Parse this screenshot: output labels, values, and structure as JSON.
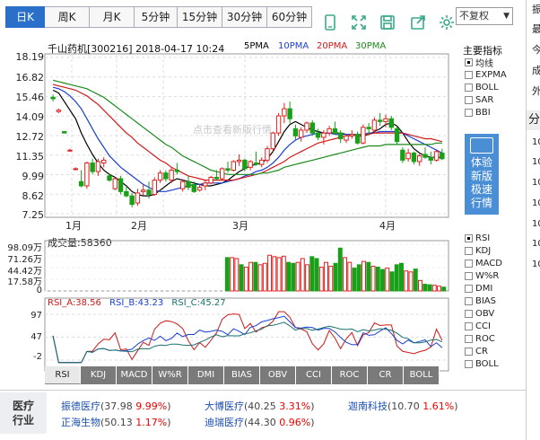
{
  "period_tabs": [
    {
      "label": "日K",
      "active": true
    },
    {
      "label": "周K",
      "active": false
    },
    {
      "label": "月K",
      "active": false
    },
    {
      "label": "5分钟",
      "active": false
    },
    {
      "label": "15分钟",
      "active": false
    },
    {
      "label": "30分钟",
      "active": false
    },
    {
      "label": "60分钟",
      "active": false
    }
  ],
  "toolbar_icons": [
    "phone-icon",
    "fullscreen-icon",
    "save-icon",
    "share-icon",
    "settings-icon"
  ],
  "fuquan": {
    "selected": "不复权"
  },
  "chart_header": {
    "stock_name": "千山药机",
    "code": "[300216]",
    "datetime": "2018-04-17 10:24",
    "ma_labels": [
      {
        "label": "5PMA",
        "color": "#000000"
      },
      {
        "label": "10PMA",
        "color": "#1a3fd0"
      },
      {
        "label": "20PMA",
        "color": "#d01818"
      },
      {
        "label": "30PMA",
        "color": "#1a8a1a"
      }
    ]
  },
  "watermark": "点击查看新版行情",
  "chart_data": {
    "type": "candlestick",
    "price_axis": {
      "ticks": [
        "18.19",
        "16.82",
        "15.46",
        "14.09",
        "12.72",
        "11.35",
        "9.99",
        "8.62",
        "7.25"
      ],
      "min": 7.25,
      "max": 18.19
    },
    "x_labels": [
      "1月",
      "2月",
      "3月",
      "4月"
    ],
    "candles": [
      [
        15.4,
        15.6,
        15.1,
        15.3
      ],
      [
        14.4,
        14.6,
        14.3,
        14.5
      ],
      [
        13.0,
        13.0,
        12.9,
        12.9
      ],
      [
        11.7,
        11.8,
        11.6,
        11.7
      ],
      [
        10.4,
        10.5,
        10.3,
        10.4
      ],
      [
        9.5,
        10.3,
        9.1,
        9.2
      ],
      [
        9.2,
        10.9,
        9.0,
        10.8
      ],
      [
        10.8,
        11.1,
        10.0,
        10.2
      ],
      [
        10.2,
        11.1,
        9.9,
        10.9
      ],
      [
        10.8,
        11.2,
        10.5,
        11.0
      ],
      [
        9.9,
        10.1,
        9.5,
        9.6
      ],
      [
        9.0,
        9.8,
        8.9,
        9.7
      ],
      [
        9.7,
        9.9,
        8.6,
        8.8
      ],
      [
        8.8,
        9.2,
        8.4,
        8.5
      ],
      [
        8.5,
        8.7,
        7.7,
        7.9
      ],
      [
        8.0,
        9.0,
        7.8,
        8.7
      ],
      [
        8.8,
        9.3,
        8.5,
        8.9
      ],
      [
        8.9,
        9.5,
        8.3,
        8.6
      ],
      [
        8.6,
        9.8,
        8.5,
        9.6
      ],
      [
        9.6,
        10.3,
        9.4,
        10.1
      ],
      [
        10.1,
        10.3,
        9.5,
        9.7
      ],
      [
        9.6,
        10.5,
        9.4,
        10.3
      ],
      [
        10.3,
        10.8,
        10.0,
        10.2
      ],
      [
        9.0,
        9.6,
        8.8,
        9.5
      ],
      [
        9.5,
        9.9,
        8.9,
        9.1
      ],
      [
        9.3,
        9.5,
        8.7,
        8.8
      ],
      [
        8.9,
        9.3,
        8.8,
        9.1
      ],
      [
        9.2,
        9.6,
        8.9,
        9.4
      ],
      [
        9.4,
        9.9,
        9.3,
        9.8
      ],
      [
        9.8,
        10.3,
        9.6,
        9.7
      ],
      [
        9.7,
        10.5,
        9.6,
        10.4
      ],
      [
        10.4,
        10.9,
        10.1,
        10.3
      ],
      [
        10.3,
        11.0,
        10.2,
        10.9
      ],
      [
        10.9,
        11.4,
        10.6,
        11.0
      ],
      [
        11.0,
        11.1,
        10.2,
        10.4
      ],
      [
        10.5,
        11.0,
        10.3,
        10.9
      ],
      [
        10.8,
        11.6,
        10.6,
        10.7
      ],
      [
        10.7,
        11.2,
        10.5,
        11.0
      ],
      [
        11.0,
        12.0,
        10.8,
        11.8
      ],
      [
        11.8,
        13.0,
        11.6,
        12.9
      ],
      [
        12.9,
        14.3,
        12.7,
        14.1
      ],
      [
        14.1,
        15.0,
        13.6,
        14.6
      ],
      [
        14.6,
        15.1,
        13.6,
        13.9
      ],
      [
        13.2,
        13.5,
        12.4,
        12.7
      ],
      [
        12.6,
        13.3,
        12.3,
        13.1
      ],
      [
        13.1,
        13.7,
        12.9,
        13.6
      ],
      [
        13.6,
        13.8,
        12.7,
        12.9
      ],
      [
        12.9,
        13.2,
        12.4,
        12.6
      ],
      [
        12.6,
        13.1,
        12.1,
        12.9
      ],
      [
        12.9,
        13.4,
        12.7,
        13.2
      ],
      [
        13.2,
        13.7,
        12.8,
        12.9
      ],
      [
        12.9,
        13.1,
        12.2,
        12.5
      ],
      [
        12.4,
        12.8,
        12.2,
        12.7
      ],
      [
        12.7,
        13.1,
        12.5,
        12.8
      ],
      [
        12.8,
        13.0,
        12.1,
        12.2
      ],
      [
        12.2,
        13.5,
        12.1,
        13.3
      ],
      [
        13.3,
        13.6,
        12.8,
        13.2
      ],
      [
        13.1,
        14.0,
        12.9,
        13.8
      ],
      [
        13.8,
        14.3,
        13.4,
        13.7
      ],
      [
        13.7,
        14.2,
        13.3,
        13.9
      ],
      [
        13.9,
        14.1,
        13.1,
        13.3
      ],
      [
        13.2,
        13.4,
        12.1,
        12.3
      ],
      [
        11.7,
        11.9,
        10.8,
        11.0
      ],
      [
        11.1,
        11.8,
        10.9,
        11.5
      ],
      [
        11.5,
        11.6,
        10.7,
        10.9
      ],
      [
        10.9,
        11.5,
        10.6,
        11.3
      ],
      [
        11.4,
        11.9,
        11.1,
        11.2
      ],
      [
        11.2,
        11.6,
        10.7,
        11.0
      ],
      [
        11.0,
        11.7,
        10.9,
        11.6
      ],
      [
        11.5,
        11.8,
        11.0,
        11.1
      ]
    ],
    "ma_series": [
      {
        "label": "5PMA",
        "color": "#000000",
        "values": [
          15.9,
          15.7,
          15.1,
          14.5,
          13.9,
          12.9,
          12.1,
          11.4,
          10.8,
          10.3,
          10.0,
          9.8,
          9.5,
          9.2,
          8.8,
          8.6,
          8.5,
          8.5,
          8.6,
          8.9,
          9.2,
          9.5,
          9.7,
          9.6,
          9.5,
          9.4,
          9.3,
          9.2,
          9.2,
          9.3,
          9.4,
          9.6,
          9.9,
          10.2,
          10.4,
          10.6,
          10.7,
          10.8,
          11.1,
          11.6,
          12.3,
          13.0,
          13.5,
          13.7,
          13.5,
          13.3,
          13.1,
          13.0,
          12.9,
          12.9,
          12.9,
          12.9,
          12.8,
          12.8,
          12.7,
          12.7,
          12.8,
          13.0,
          13.2,
          13.5,
          13.6,
          13.4,
          12.9,
          12.3,
          11.8,
          11.5,
          11.3,
          11.2,
          11.2,
          11.2
        ]
      },
      {
        "label": "10PMA",
        "color": "#1a3fd0",
        "values": [
          16.1,
          16.0,
          15.8,
          15.5,
          15.1,
          14.6,
          13.9,
          13.2,
          12.5,
          11.9,
          11.3,
          10.9,
          10.5,
          10.2,
          9.9,
          9.6,
          9.3,
          9.1,
          8.9,
          8.8,
          8.8,
          8.9,
          9.0,
          9.1,
          9.2,
          9.3,
          9.3,
          9.4,
          9.4,
          9.4,
          9.4,
          9.5,
          9.6,
          9.7,
          9.9,
          10.0,
          10.2,
          10.3,
          10.5,
          10.8,
          11.2,
          11.7,
          12.1,
          12.4,
          12.6,
          12.7,
          12.8,
          12.9,
          12.9,
          12.9,
          12.8,
          12.8,
          12.8,
          12.8,
          12.8,
          12.8,
          12.9,
          12.9,
          13.0,
          13.0,
          13.0,
          13.0,
          12.9,
          12.7,
          12.5,
          12.3,
          12.1,
          11.9,
          11.7,
          11.5
        ]
      },
      {
        "label": "20PMA",
        "color": "#d01818",
        "values": [
          16.3,
          16.2,
          16.1,
          16.0,
          15.9,
          15.7,
          15.5,
          15.2,
          14.9,
          14.5,
          14.1,
          13.7,
          13.3,
          12.9,
          12.6,
          12.2,
          11.9,
          11.6,
          11.3,
          11.0,
          10.8,
          10.5,
          10.3,
          10.1,
          9.9,
          9.8,
          9.7,
          9.6,
          9.6,
          9.6,
          9.6,
          9.6,
          9.6,
          9.7,
          9.8,
          9.9,
          10.0,
          10.1,
          10.3,
          10.5,
          10.7,
          10.9,
          11.2,
          11.4,
          11.6,
          11.8,
          12.0,
          12.2,
          12.3,
          12.4,
          12.5,
          12.6,
          12.7,
          12.7,
          12.8,
          12.8,
          12.8,
          12.9,
          12.9,
          12.9,
          12.9,
          12.9,
          12.9,
          12.8,
          12.7,
          12.6,
          12.5,
          12.5,
          12.4,
          12.3
        ]
      },
      {
        "label": "30PMA",
        "color": "#1a8a1a",
        "values": [
          16.6,
          16.5,
          16.4,
          16.3,
          16.2,
          16.1,
          16.0,
          15.8,
          15.6,
          15.4,
          15.1,
          14.8,
          14.5,
          14.2,
          13.9,
          13.6,
          13.3,
          13.0,
          12.7,
          12.4,
          12.1,
          11.9,
          11.6,
          11.3,
          11.1,
          10.9,
          10.7,
          10.5,
          10.3,
          10.2,
          10.1,
          10.0,
          10.0,
          10.0,
          10.0,
          10.0,
          10.0,
          10.1,
          10.1,
          10.2,
          10.3,
          10.5,
          10.6,
          10.7,
          10.8,
          10.9,
          11.0,
          11.1,
          11.2,
          11.3,
          11.4,
          11.5,
          11.6,
          11.7,
          11.8,
          11.9,
          12.0,
          12.0,
          12.0,
          12.1,
          12.1,
          12.1,
          12.1,
          12.1,
          12.1,
          12.1,
          12.1,
          12.1,
          12.2,
          12.2
        ]
      }
    ],
    "volume": {
      "title": "成交量:58360",
      "ticks": [
        "98.09万",
        "71.26万",
        "44.42万",
        "17.58万",
        "0"
      ],
      "max": 98.09,
      "values": [
        0,
        0,
        0,
        0,
        0,
        0,
        0,
        0,
        0,
        0,
        0,
        0,
        0,
        0,
        0,
        0,
        0,
        0,
        0,
        0,
        0,
        0,
        0,
        0,
        0,
        0,
        0,
        0,
        0,
        0,
        0,
        0,
        0,
        0,
        0,
        0,
        0,
        0,
        70,
        70,
        68,
        55,
        50,
        60,
        60,
        55,
        58,
        75,
        72,
        70,
        73,
        60,
        58,
        60,
        68,
        55,
        72,
        68,
        50,
        60,
        52,
        58,
        90,
        70,
        60,
        48,
        55,
        62,
        60,
        52,
        50,
        45,
        48,
        40,
        55,
        58,
        42,
        40,
        46,
        22,
        14,
        13,
        12,
        10,
        8
      ]
    },
    "rsi": {
      "title_a": "RSI_A:38.56",
      "title_b": "RSI_B:43.23",
      "title_c": "RSI_C:45.27",
      "ticks": [
        "97",
        "47",
        "-2"
      ],
      "min": -2,
      "max": 97
    }
  },
  "indicator_tabs": [
    {
      "label": "RSI",
      "active": true
    },
    {
      "label": "KDJ",
      "active": false
    },
    {
      "label": "MACD",
      "active": false
    },
    {
      "label": "W%R",
      "active": false
    },
    {
      "label": "DMI",
      "active": false
    },
    {
      "label": "BIAS",
      "active": false
    },
    {
      "label": "OBV",
      "active": false
    },
    {
      "label": "CCI",
      "active": false
    },
    {
      "label": "ROC",
      "active": false
    },
    {
      "label": "CR",
      "active": false
    },
    {
      "label": "BOLL",
      "active": false
    }
  ],
  "side_main": {
    "title": "主要指标",
    "options": [
      {
        "label": "均线",
        "checked": true
      },
      {
        "label": "EXPMA",
        "checked": false
      },
      {
        "label": "BOLL",
        "checked": false
      },
      {
        "label": "SAR",
        "checked": false
      },
      {
        "label": "BBI",
        "checked": false
      }
    ]
  },
  "side_sub": {
    "options": [
      {
        "label": "RSI",
        "checked": true
      },
      {
        "label": "KDJ",
        "checked": false
      },
      {
        "label": "MACD",
        "checked": false
      },
      {
        "label": "W%R",
        "checked": false
      },
      {
        "label": "DMI",
        "checked": false
      },
      {
        "label": "BIAS",
        "checked": false
      },
      {
        "label": "OBV",
        "checked": false
      },
      {
        "label": "CCI",
        "checked": false
      },
      {
        "label": "ROC",
        "checked": false
      },
      {
        "label": "CR",
        "checked": false
      },
      {
        "label": "BOLL",
        "checked": false
      }
    ]
  },
  "promo": {
    "lines": [
      "体验",
      "新版",
      "极速",
      "行情"
    ]
  },
  "right_panel": {
    "items": [
      "振",
      "最",
      "今",
      "成",
      "外",
      "分",
      "10",
      "10",
      "10",
      "10",
      "10",
      "10",
      "10"
    ]
  },
  "industry": {
    "label_line1": "医疗",
    "label_line2": "行业",
    "stocks": [
      {
        "name": "振德医疗",
        "price": "(37.98",
        "pct": "9.99%",
        "close": ")"
      },
      {
        "name": "大博医疗",
        "price": "(40.25",
        "pct": "3.31%",
        "close": ")"
      },
      {
        "name": "迦南科技",
        "price": "(10.70",
        "pct": "1.61%",
        "close": ")"
      },
      {
        "name": "正海生物",
        "price": "(50.13",
        "pct": "1.17%",
        "close": ")"
      },
      {
        "name": "迪瑞医疗",
        "price": "(44.30",
        "pct": "0.96%",
        "close": ")"
      }
    ]
  }
}
